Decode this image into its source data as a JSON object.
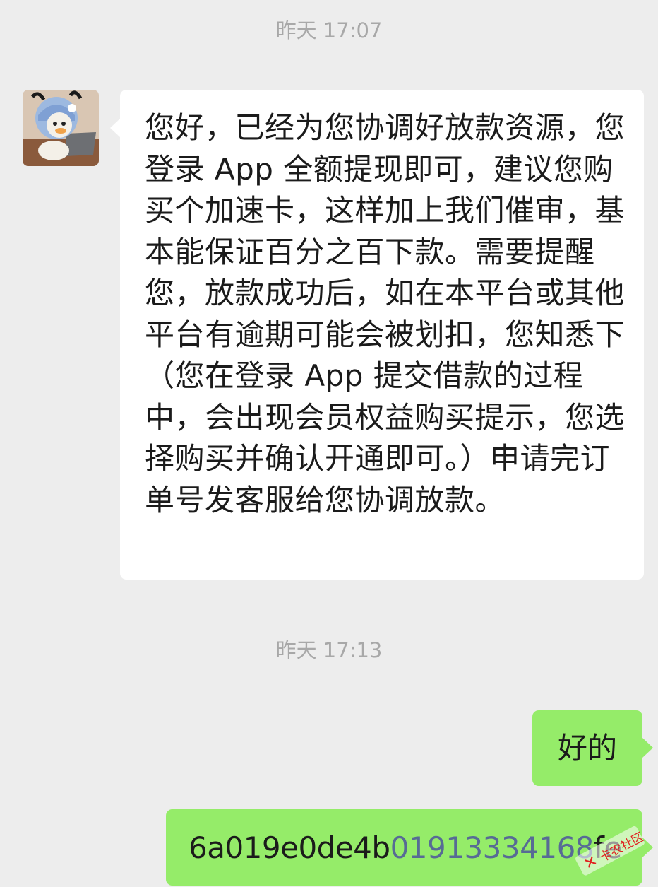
{
  "timestamps": [
    "昨天 17:07",
    "昨天 17:13"
  ],
  "messages": {
    "incoming": {
      "text": "您好，已经为您协调好放款资源，您登录 App 全额提现即可，建议您购买个加速卡，这样加上我们催审，基本能保证百分之百下款。需要提醒您，放款成功后，如在本平台或其他平台有逾期可能会被划扣，您知悉下（您在登录 App 提交借款的过程中，会出现会员权益购买提示，您选择购买并确认开通即可。）申请完订单号发客服给您协调放款。"
    },
    "outgoing_ok": {
      "text": "好的"
    },
    "outgoing_id": {
      "prefix": "6a019e0de4b",
      "phone_link": "01913334168",
      "suffix": "fe"
    }
  },
  "watermark": {
    "text": "卡农社区"
  },
  "colors": {
    "background": "#ededed",
    "incoming_bubble": "#ffffff",
    "outgoing_bubble": "#95ec69",
    "link": "#576b95",
    "timestamp": "#a8a8a8"
  }
}
